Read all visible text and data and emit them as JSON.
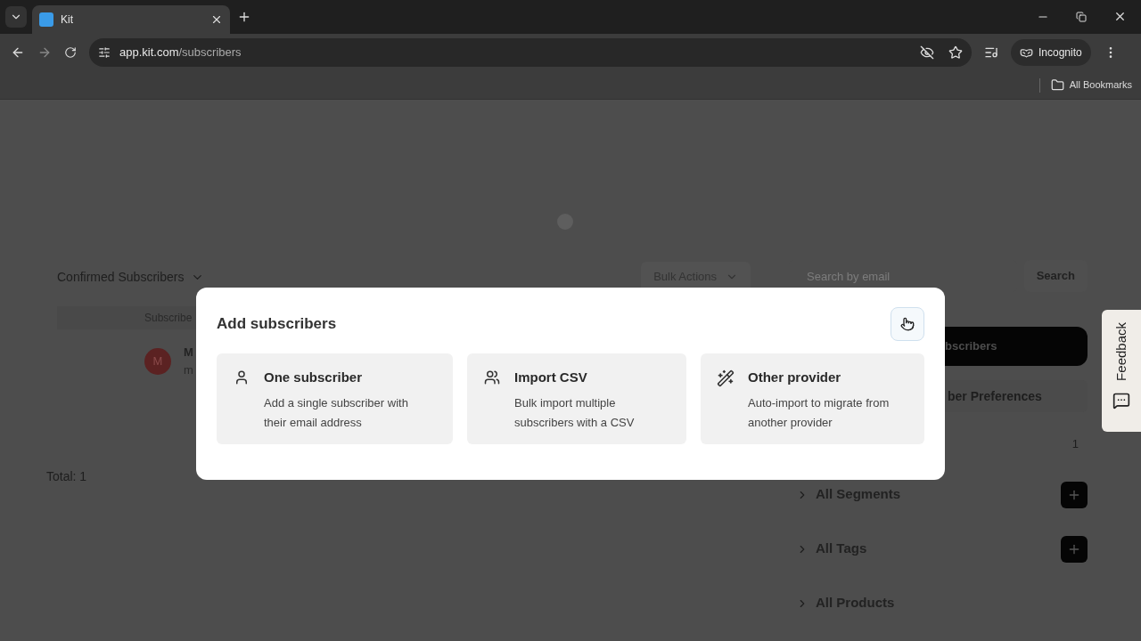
{
  "browser": {
    "tab_title": "Kit",
    "url_host": "app.kit.com",
    "url_path": "/subscribers",
    "profile": "Incognito",
    "bookmarks": "All Bookmarks"
  },
  "page": {
    "filter": "Confirmed Subscribers",
    "bulk_actions": "Bulk Actions",
    "search_placeholder": "Search by email",
    "search_button": "Search",
    "table_header": "Subscribe",
    "row": {
      "avatar": "M",
      "name": "M",
      "email": "m"
    },
    "total": "Total: 1",
    "add_button": "bscribers",
    "preferences": "ber Preferences",
    "count": "1",
    "sections": [
      {
        "label": "All Segments",
        "add_button": true
      },
      {
        "label": "All Tags",
        "add_button": true
      },
      {
        "label": "All Products",
        "add_button": false
      }
    ]
  },
  "modal": {
    "title": "Add subscribers",
    "options": [
      {
        "kind": "person",
        "title": "One subscriber",
        "description": "Add a single subscriber with their email address"
      },
      {
        "kind": "group",
        "title": "Import CSV",
        "description": "Bulk import multiple subscribers with a CSV"
      },
      {
        "kind": "wand",
        "title": "Other provider",
        "description": "Auto-import to migrate from another provider"
      }
    ]
  },
  "feedback": "Feedback"
}
